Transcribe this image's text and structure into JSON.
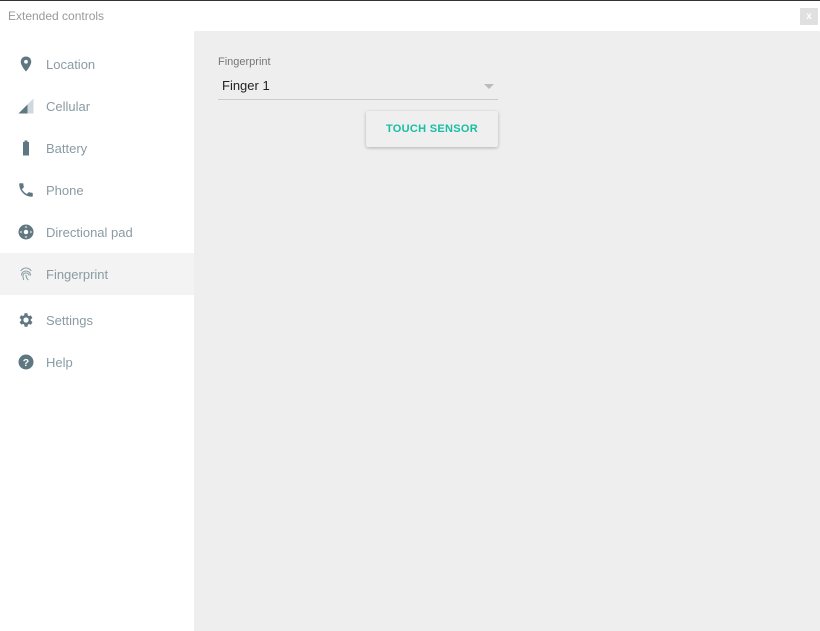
{
  "window": {
    "title": "Extended controls",
    "close_label": "x"
  },
  "sidebar": {
    "items": [
      {
        "label": "Location",
        "icon": "location-pin-icon"
      },
      {
        "label": "Cellular",
        "icon": "cellular-signal-icon"
      },
      {
        "label": "Battery",
        "icon": "battery-icon"
      },
      {
        "label": "Phone",
        "icon": "phone-icon"
      },
      {
        "label": "Directional pad",
        "icon": "dpad-icon"
      },
      {
        "label": "Fingerprint",
        "icon": "fingerprint-icon",
        "active": true
      },
      {
        "label": "Settings",
        "icon": "gear-icon"
      },
      {
        "label": "Help",
        "icon": "help-icon"
      }
    ]
  },
  "fingerprint": {
    "field_label": "Fingerprint",
    "selected": "Finger 1",
    "touch_button": "TOUCH SENSOR"
  },
  "colors": {
    "accent": "#17bfa2",
    "icon": "#5f7781"
  }
}
